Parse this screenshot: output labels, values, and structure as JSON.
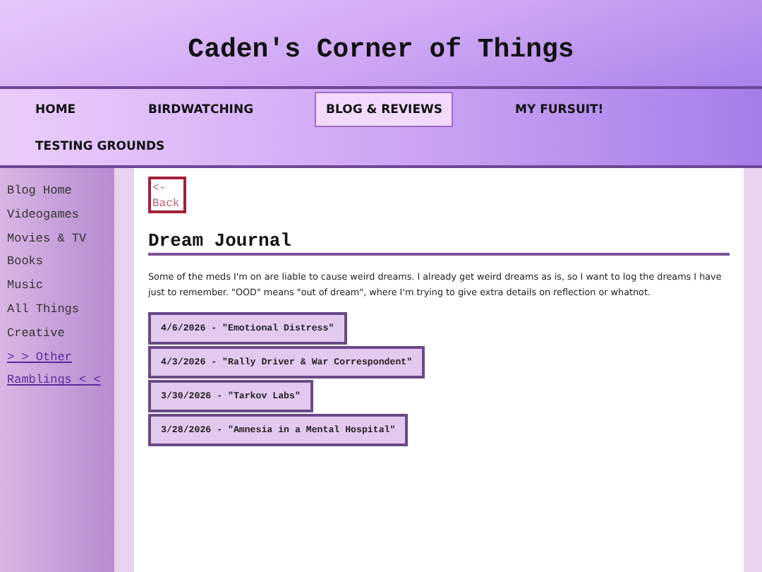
{
  "site_title": "Caden's Corner of Things",
  "nav": [
    {
      "label": "HOME",
      "selected": false
    },
    {
      "label": "BIRDWATCHING",
      "selected": false
    },
    {
      "label": "BLOG & REVIEWS",
      "selected": true
    },
    {
      "label": "MY FURSUIT!",
      "selected": false
    },
    {
      "label": "TESTING GROUNDS",
      "selected": false
    }
  ],
  "sidebar": [
    {
      "label": "Blog Home",
      "kind": "plain"
    },
    {
      "label": "Videogames",
      "kind": "plain"
    },
    {
      "label": "Movies & TV",
      "kind": "plain"
    },
    {
      "label": "Books",
      "kind": "plain"
    },
    {
      "label": "Music",
      "kind": "plain"
    },
    {
      "label": "All Things",
      "kind": "plain"
    },
    {
      "label": "Creative",
      "kind": "plain"
    },
    {
      "label": "> > Other",
      "kind": "link"
    },
    {
      "label": "Ramblings < <",
      "kind": "link"
    }
  ],
  "back_button": {
    "line1": "<-",
    "line2": "Back"
  },
  "heading": "Dream Journal",
  "intro": "Some of the meds I'm on are liable to cause weird dreams. I already get weird dreams as is, so I want to log the dreams I have just to remember. \"OOD\" means \"out of dream\", where I'm trying to give extra details on reflection or whatnot.",
  "entries": [
    "4/6/2026 - \"Emotional Distress\"",
    "4/3/2026 - \"Rally Driver & War Correspondent\"",
    "3/30/2026 - \"Tarkov Labs\"",
    "3/28/2026 - \"Amnesia in a Mental Hospital\""
  ]
}
